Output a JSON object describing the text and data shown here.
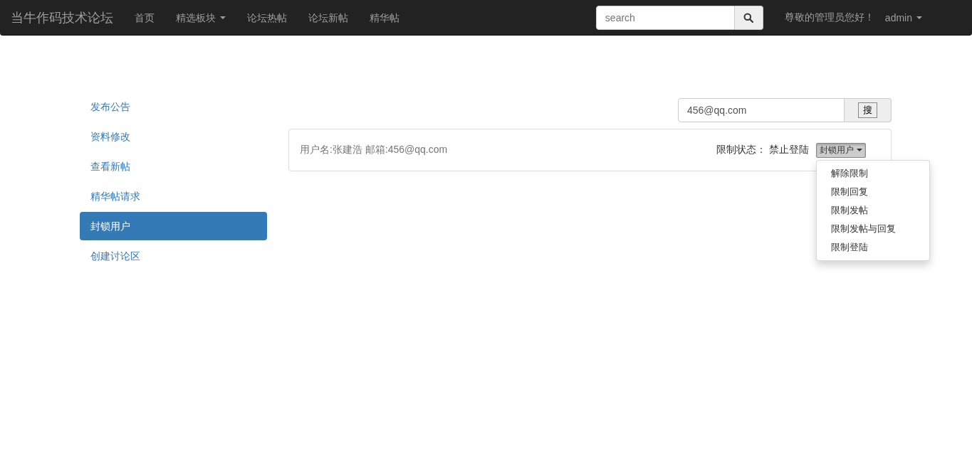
{
  "navbar": {
    "brand": "当牛作码技术论坛",
    "links": [
      {
        "label": "首页",
        "dropdown": false
      },
      {
        "label": "精选板块",
        "dropdown": true
      },
      {
        "label": "论坛热帖",
        "dropdown": false
      },
      {
        "label": "论坛新帖",
        "dropdown": false
      },
      {
        "label": "精华帖",
        "dropdown": false
      }
    ],
    "search": {
      "placeholder": "search"
    },
    "greeting": "尊敬的管理员您好！",
    "user": "admin"
  },
  "sidebar": {
    "items": [
      {
        "label": "发布公告",
        "selected": false
      },
      {
        "label": "资料修改",
        "selected": false
      },
      {
        "label": "查看新帖",
        "selected": false
      },
      {
        "label": "精华帖请求",
        "selected": false
      },
      {
        "label": "封锁用户",
        "selected": true
      },
      {
        "label": "创建讨论区",
        "selected": false
      }
    ]
  },
  "user_search": {
    "value": "456@qq.com",
    "button": "搜"
  },
  "result": {
    "user_info": "用户名:张建浩 邮箱:456@qq.com",
    "status_label": "限制状态：",
    "status_value": "禁止登陆",
    "action": {
      "label": "封锁用户",
      "expanded": true,
      "options": [
        "解除限制",
        "限制回复",
        "限制发帖",
        "限制发帖与回复",
        "限制登陆"
      ]
    }
  }
}
